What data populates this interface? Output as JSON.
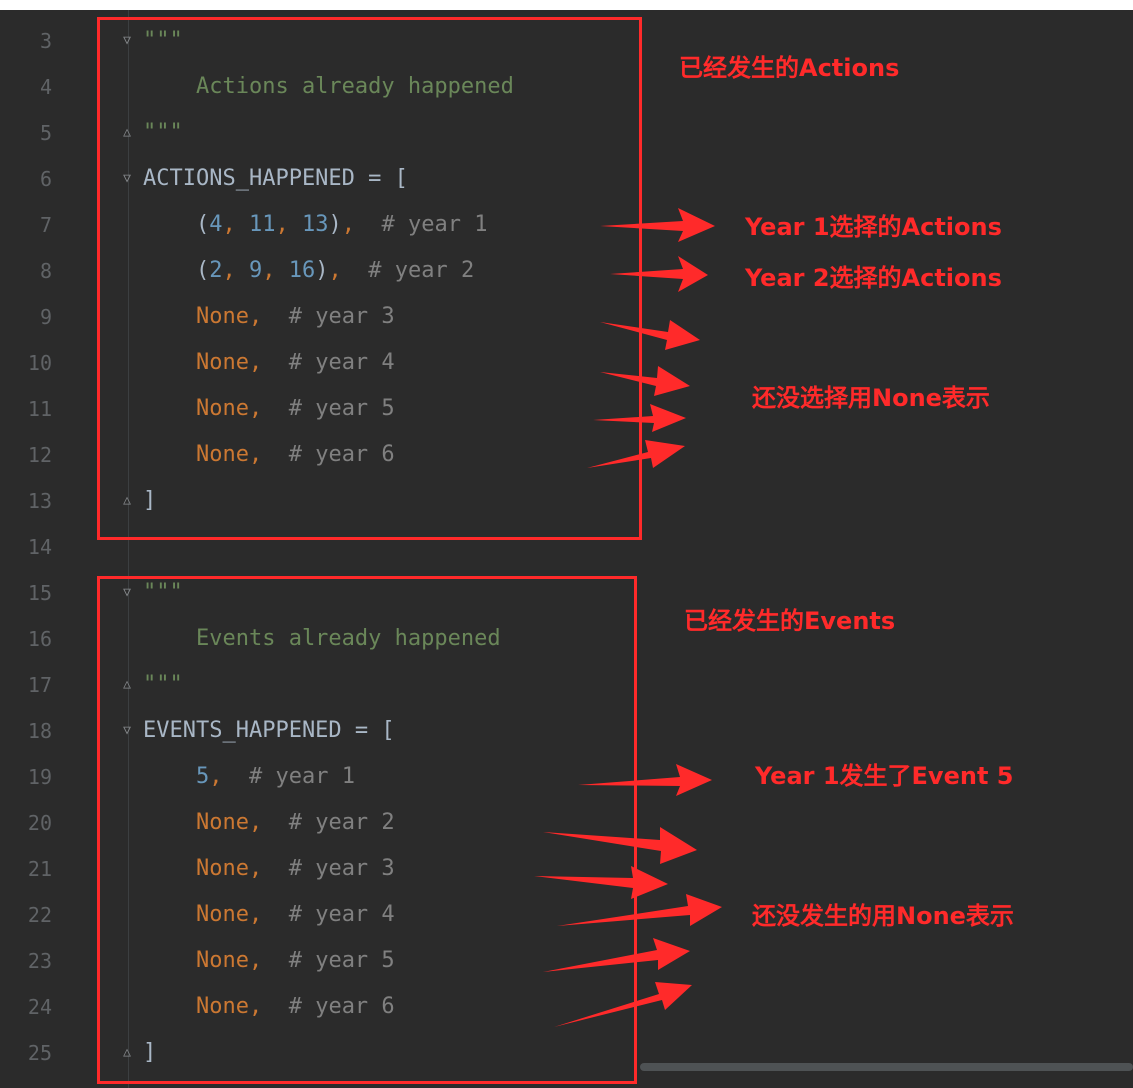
{
  "editor": {
    "line_numbers": [
      "3",
      "4",
      "5",
      "6",
      "7",
      "8",
      "9",
      "10",
      "11",
      "12",
      "13",
      "14",
      "15",
      "16",
      "17",
      "18",
      "19",
      "20",
      "21",
      "22",
      "23",
      "24",
      "25"
    ],
    "lines": {
      "l3": {
        "text": "\"\"\""
      },
      "l4": {
        "text": "    Actions already happened"
      },
      "l5": {
        "text": "\"\"\""
      },
      "l6": {
        "name": "ACTIONS_HAPPENED",
        "op": " = ["
      },
      "l7": {
        "p1": "    (",
        "n1": "4",
        "s1": ", ",
        "n2": "11",
        "s2": ", ",
        "n3": "13",
        "p2": ")",
        "c1": ",",
        "cmt": "  # year 1"
      },
      "l8": {
        "p1": "    (",
        "n1": "2",
        "s1": ", ",
        "n2": "9",
        "s2": ", ",
        "n3": "16",
        "p2": ")",
        "c1": ",",
        "cmt": "  # year 2"
      },
      "l9": {
        "kw": "    None,",
        "cmt": "  # year 3"
      },
      "l10": {
        "kw": "    None,",
        "cmt": "  # year 4"
      },
      "l11": {
        "kw": "    None,",
        "cmt": "  # year 5"
      },
      "l12": {
        "kw": "    None,",
        "cmt": "  # year 6"
      },
      "l13": {
        "text": "]"
      },
      "l15": {
        "text": "\"\"\""
      },
      "l16": {
        "text": "    Events already happened"
      },
      "l17": {
        "text": "\"\"\""
      },
      "l18": {
        "name": "EVENTS_HAPPENED",
        "op": " = ["
      },
      "l19": {
        "n": "    5",
        "c": ",",
        "cmt": "  # year 1"
      },
      "l20": {
        "kw": "    None,",
        "cmt": "  # year 2"
      },
      "l21": {
        "kw": "    None,",
        "cmt": "  # year 3"
      },
      "l22": {
        "kw": "    None,",
        "cmt": "  # year 4"
      },
      "l23": {
        "kw": "    None,",
        "cmt": "  # year 5"
      },
      "l24": {
        "kw": "    None,",
        "cmt": "  # year 6"
      },
      "l25": {
        "text": "]"
      }
    }
  },
  "annotations": {
    "actions_title": "已经发生的Actions",
    "year1_actions": "Year 1选择的Actions",
    "year2_actions": "Year 2选择的Actions",
    "actions_none": "还没选择用None表示",
    "events_title": "已经发生的Events",
    "year1_event": "Year 1发生了Event 5",
    "events_none": "还没发生的用None表示"
  },
  "colors": {
    "background": "#2b2b2b",
    "string": "#6a8759",
    "number": "#6897bb",
    "keyword": "#cc7832",
    "comment": "#808080",
    "annotation": "#ff2a2a"
  }
}
